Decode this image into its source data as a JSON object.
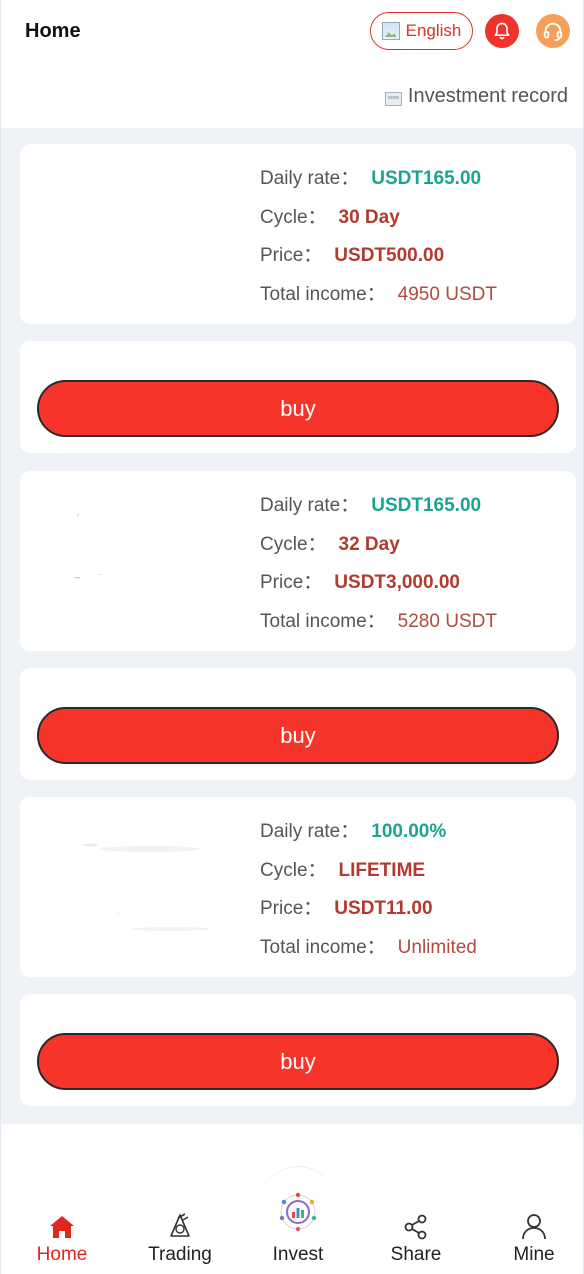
{
  "header": {
    "title": "Home",
    "language_label": "English",
    "record_label": "Investment record"
  },
  "products": [
    {
      "daily_rate_label": "Daily rate：",
      "daily_rate": "USDT165.00",
      "cycle_label": "Cycle：",
      "cycle": "30 Day",
      "price_label": "Price：",
      "price": "USDT500.00",
      "income_label": "Total income：",
      "income": "4950 USDT",
      "buy_label": "buy"
    },
    {
      "daily_rate_label": "Daily rate：",
      "daily_rate": "USDT165.00",
      "cycle_label": "Cycle：",
      "cycle": "32 Day",
      "price_label": "Price：",
      "price": "USDT3,000.00",
      "income_label": "Total income：",
      "income": "5280 USDT",
      "buy_label": "buy"
    },
    {
      "daily_rate_label": "Daily rate：",
      "daily_rate": "100.00%",
      "cycle_label": "Cycle：",
      "cycle": "LIFETIME",
      "price_label": "Price：",
      "price": "USDT11.00",
      "income_label": "Total income：",
      "income": "Unlimited",
      "buy_label": "buy"
    }
  ],
  "nav": {
    "items": [
      {
        "label": "Home",
        "icon": "home-icon",
        "active": true
      },
      {
        "label": "Trading",
        "icon": "trading-icon",
        "active": false
      },
      {
        "label": "Invest",
        "icon": "invest-icon",
        "active": false
      },
      {
        "label": "Share",
        "icon": "share-icon",
        "active": false
      },
      {
        "label": "Mine",
        "icon": "user-icon",
        "active": false
      }
    ]
  },
  "colors": {
    "accent_red": "#f7342a",
    "rate_green": "#1aa592",
    "value_red": "#b23a2f",
    "support_orange": "#f5a05a",
    "page_bg": "#eff2f7"
  }
}
